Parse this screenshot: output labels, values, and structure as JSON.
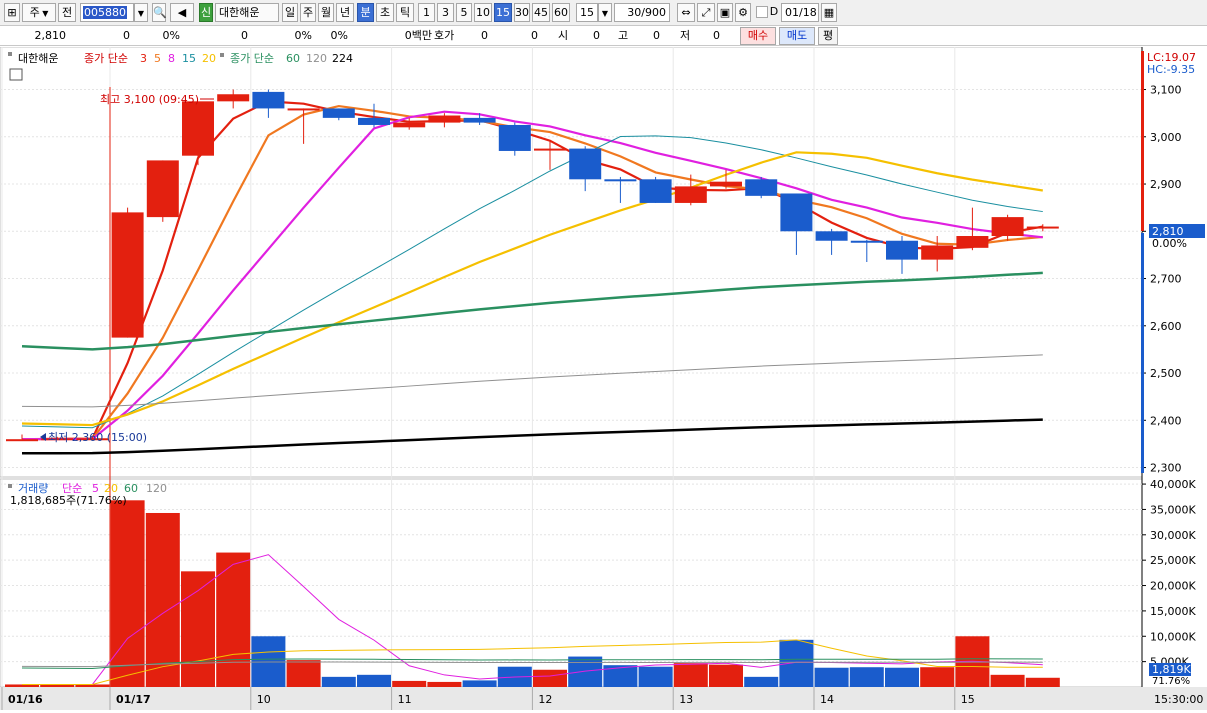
{
  "toolbar": {
    "type_label": "주",
    "prev_label": "전",
    "stock_code": "005880",
    "speaker": "◀",
    "new_badge": "신",
    "stock_name": "대한해운",
    "period_buttons": [
      "일",
      "주",
      "월",
      "년",
      "분",
      "초",
      "틱"
    ],
    "selected_period": "분",
    "interval_buttons": [
      "1",
      "3",
      "5",
      "10",
      "15",
      "30",
      "45",
      "60"
    ],
    "selected_interval": "15",
    "interval_value": "15",
    "count_value": "30/900",
    "check_label": "D",
    "date_value": "01/18"
  },
  "quote_row": {
    "price": "2,810",
    "change": "0",
    "change_pct": "0%",
    "volume": "0",
    "vol_pct": "0%",
    "amount": "0",
    "amount_unit": "0백만",
    "hoga_label": "호가",
    "hoga_val1": "0",
    "hoga_val2": "0",
    "open_label": "시",
    "open_val": "0",
    "high_label": "고",
    "high_val": "0",
    "low_label": "저",
    "low_val": "0",
    "buy_label": "매수",
    "sell_label": "매도",
    "flat_label": "평"
  },
  "price_panel": {
    "legend_name": "대한해운",
    "legend_ma_label": "종가 단순",
    "legend_ma_short": [
      "3",
      "5",
      "8",
      "15",
      "20"
    ],
    "legend_ma2_label": "종가 단순",
    "legend_ma_long": [
      "60",
      "120",
      "224"
    ],
    "lc_label": "LC:19.07",
    "hc_label": "HC:-9.35",
    "current_price_label": "2,810",
    "current_pct_label": "0.00%",
    "high_annotation": "최고 3,100 (09:45)",
    "low_annotation": "최저 2,360 (15:00)"
  },
  "volume_panel": {
    "legend_name": "거래량",
    "legend_ma_label": "단순",
    "legend_ma": [
      "5",
      "20",
      "60",
      "120"
    ],
    "summary": "1,818,685주(71.76%)",
    "current_label": "1,819K",
    "current_pct": "71.76%"
  },
  "x_axis": {
    "labels": [
      "01/16",
      "01/17",
      "10",
      "11",
      "12",
      "13",
      "14",
      "15"
    ],
    "time_label": "15:30:00"
  },
  "colors": {
    "up": "#e3200f",
    "down": "#1a5ccc",
    "ma3": "#e3200f",
    "ma5": "#f07820",
    "ma8": "#e020e0",
    "ma15": "#1a8fa0",
    "ma20": "#f5c000",
    "ma60": "#2a9060",
    "ma120": "#909090",
    "ma224": "#000000"
  },
  "chart_data": {
    "type": "candlestick",
    "price_axis": {
      "ticks": [
        3100,
        3000,
        2900,
        2800,
        2700,
        2600,
        2500,
        2400,
        2300
      ],
      "range": [
        2280,
        3190
      ]
    },
    "volume_axis": {
      "ticks": [
        "40,000K",
        "35,000K",
        "30,000K",
        "25,000K",
        "20,000K",
        "15,000K",
        "10,000K",
        "5,000K"
      ],
      "range": [
        0,
        41000
      ]
    },
    "candles": [
      {
        "o": 2360,
        "h": 2370,
        "l": 2360,
        "c": 2360,
        "v": 500
      },
      {
        "o": 2360,
        "h": 2365,
        "l": 2360,
        "c": 2362,
        "v": 500
      },
      {
        "o": 2362,
        "h": 2365,
        "l": 2360,
        "c": 2362,
        "v": 500
      },
      {
        "o": 2575,
        "h": 2850,
        "l": 2575,
        "c": 2840,
        "v": 36800
      },
      {
        "o": 2830,
        "h": 2950,
        "l": 2820,
        "c": 2950,
        "v": 34300
      },
      {
        "o": 2960,
        "h": 3000,
        "l": 2940,
        "c": 3075,
        "v": 22800
      },
      {
        "o": 3075,
        "h": 3100,
        "l": 3060,
        "c": 3090,
        "v": 26500
      },
      {
        "o": 3095,
        "h": 3100,
        "l": 3040,
        "c": 3060,
        "v": 10000
      },
      {
        "o": 3060,
        "h": 3060,
        "l": 2985,
        "c": 3060,
        "v": 5300
      },
      {
        "o": 3060,
        "h": 3060,
        "l": 3035,
        "c": 3040,
        "v": 2000
      },
      {
        "o": 3040,
        "h": 3070,
        "l": 3020,
        "c": 3025,
        "v": 2400
      },
      {
        "o": 3020,
        "h": 3040,
        "l": 3015,
        "c": 3030,
        "v": 1200
      },
      {
        "o": 3030,
        "h": 3050,
        "l": 3020,
        "c": 3045,
        "v": 1000
      },
      {
        "o": 3040,
        "h": 3050,
        "l": 3025,
        "c": 3030,
        "v": 1300
      },
      {
        "o": 3025,
        "h": 3030,
        "l": 2960,
        "c": 2970,
        "v": 4000
      },
      {
        "o": 2975,
        "h": 2990,
        "l": 2930,
        "c": 2975,
        "v": 3400
      },
      {
        "o": 2975,
        "h": 2980,
        "l": 2885,
        "c": 2910,
        "v": 6000
      },
      {
        "o": 2910,
        "h": 2915,
        "l": 2860,
        "c": 2908,
        "v": 4300
      },
      {
        "o": 2910,
        "h": 2915,
        "l": 2860,
        "c": 2860,
        "v": 4000
      },
      {
        "o": 2860,
        "h": 2920,
        "l": 2855,
        "c": 2895,
        "v": 4700
      },
      {
        "o": 2895,
        "h": 2930,
        "l": 2890,
        "c": 2905,
        "v": 4400
      },
      {
        "o": 2910,
        "h": 2915,
        "l": 2870,
        "c": 2875,
        "v": 2000
      },
      {
        "o": 2880,
        "h": 2880,
        "l": 2750,
        "c": 2800,
        "v": 9300
      },
      {
        "o": 2800,
        "h": 2805,
        "l": 2750,
        "c": 2780,
        "v": 3800
      },
      {
        "o": 2780,
        "h": 2782,
        "l": 2735,
        "c": 2778,
        "v": 3900
      },
      {
        "o": 2780,
        "h": 2790,
        "l": 2710,
        "c": 2740,
        "v": 3800
      },
      {
        "o": 2740,
        "h": 2790,
        "l": 2715,
        "c": 2770,
        "v": 3900
      },
      {
        "o": 2765,
        "h": 2850,
        "l": 2760,
        "c": 2790,
        "v": 10000
      },
      {
        "o": 2790,
        "h": 2835,
        "l": 2780,
        "c": 2830,
        "v": 2400
      },
      {
        "o": 2810,
        "h": 2815,
        "l": 2800,
        "c": 2810,
        "v": 1819
      }
    ]
  }
}
